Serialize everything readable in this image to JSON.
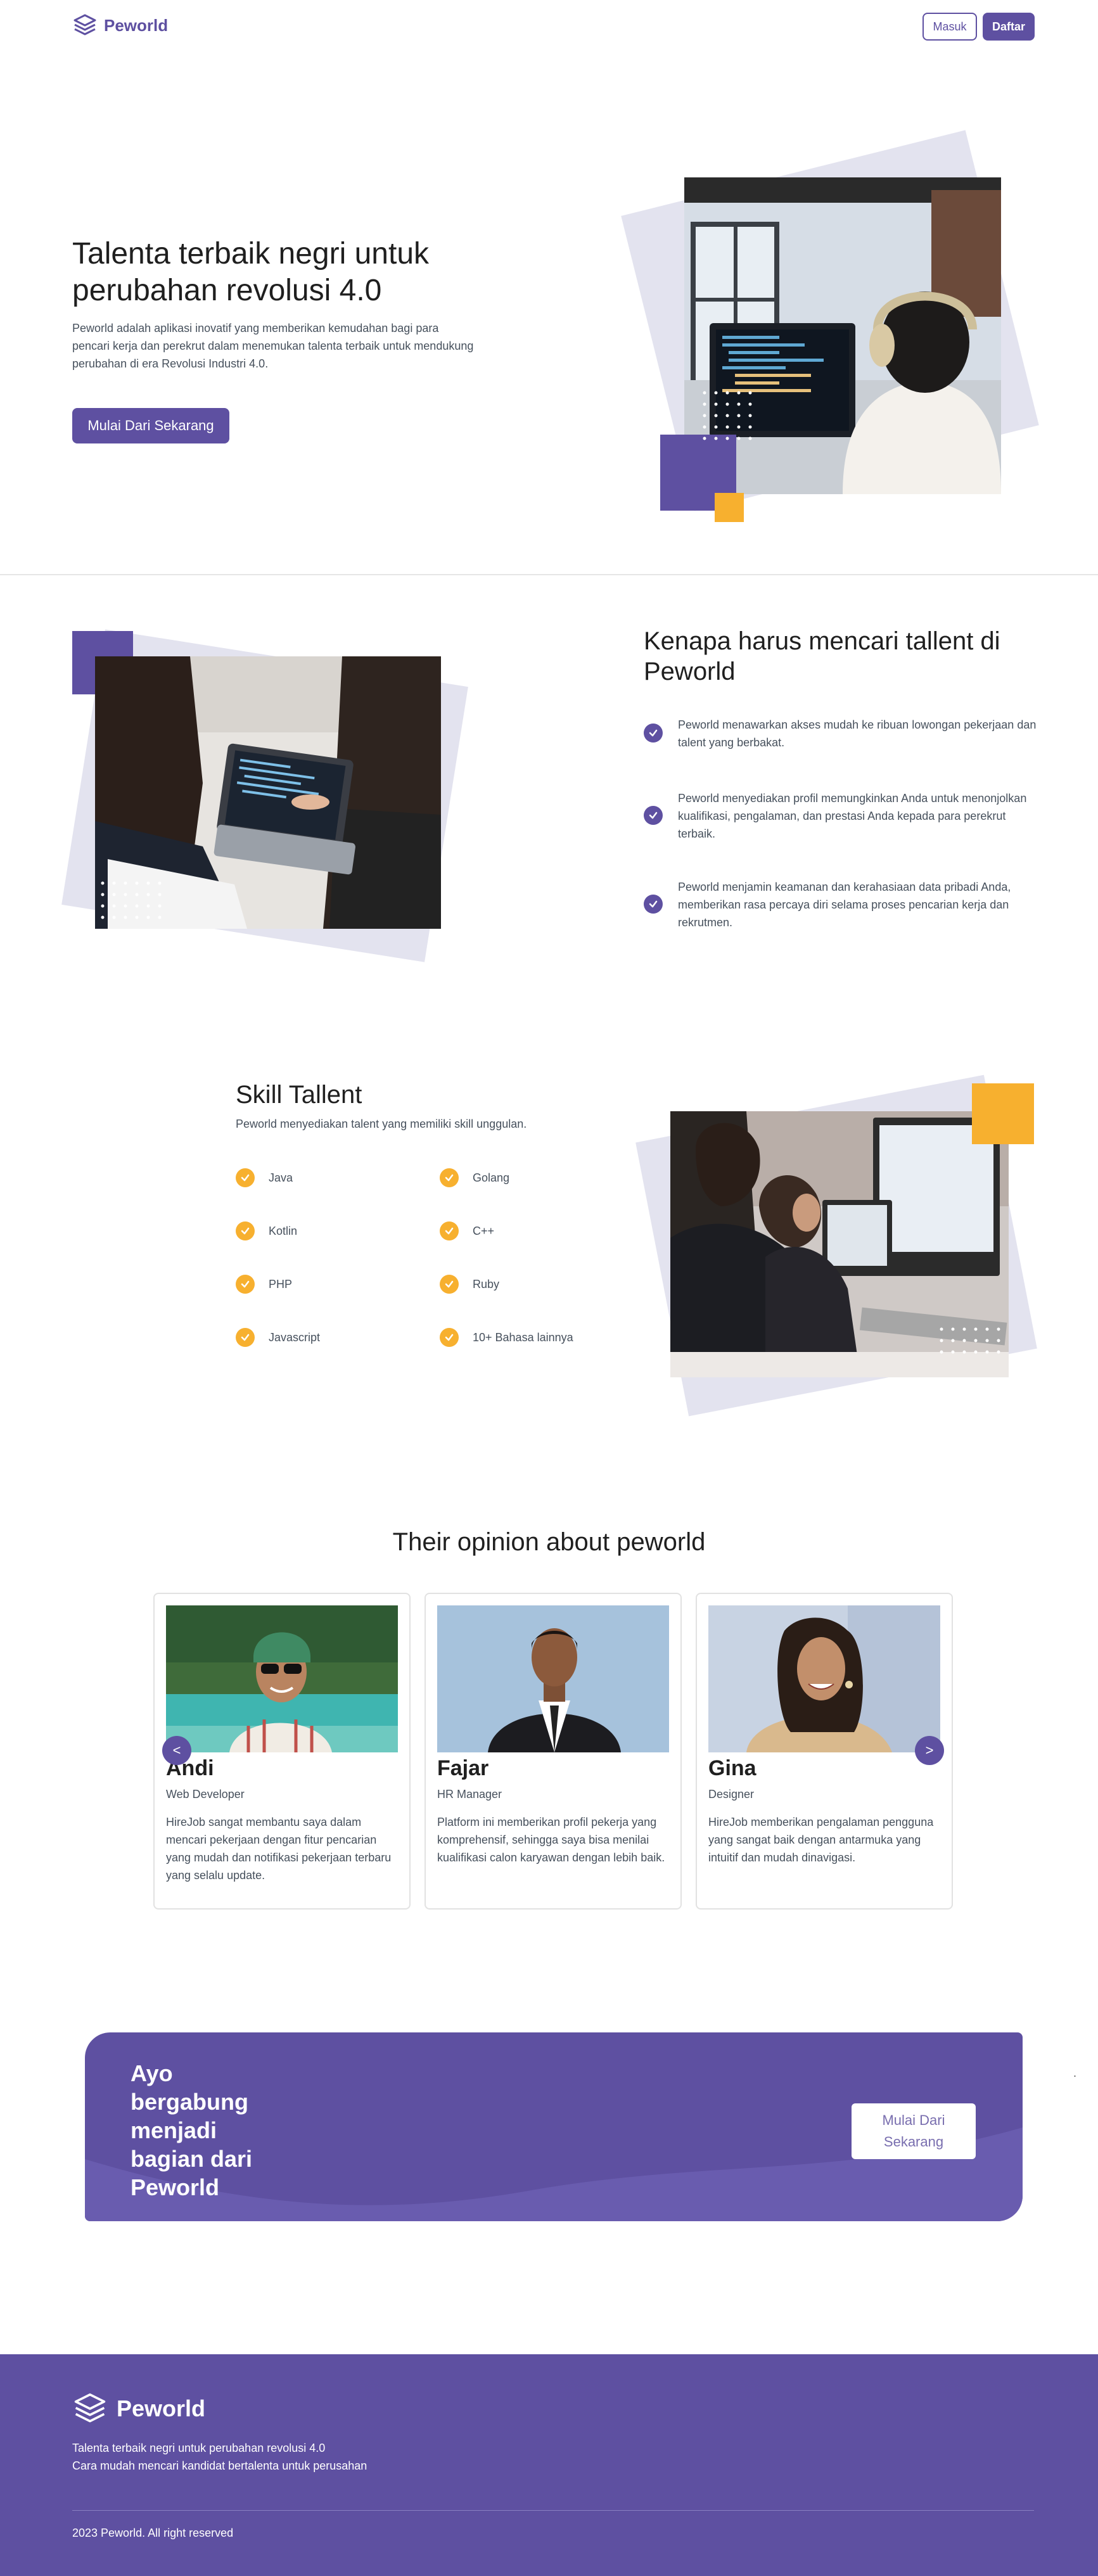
{
  "colors": {
    "primary": "#5e50a1",
    "accent": "#f7b02f",
    "text": "#1f1f1f",
    "muted": "#46505c"
  },
  "nav": {
    "brand": "Peworld",
    "login_label": "Masuk",
    "register_label": "Daftar"
  },
  "hero": {
    "title": "Talenta terbaik negri untuk perubahan revolusi 4.0",
    "description": "Peworld adalah aplikasi inovatif yang memberikan kemudahan bagi para pencari kerja dan perekrut dalam menemukan talenta terbaik untuk mendukung perubahan di era Revolusi Industri 4.0.",
    "cta_label": "Mulai Dari Sekarang"
  },
  "why": {
    "title": "Kenapa harus mencari tallent di Peworld",
    "items": [
      {
        "text": "Peworld menawarkan akses mudah ke ribuan lowongan pekerjaan dan talent yang berbakat."
      },
      {
        "text": "Peworld menyediakan profil memungkinkan Anda untuk menonjolkan kualifikasi, pengalaman, dan prestasi Anda kepada para perekrut terbaik."
      },
      {
        "text": "Peworld menjamin keamanan dan kerahasiaan data pribadi Anda, memberikan rasa percaya diri selama proses pencarian kerja dan rekrutmen."
      }
    ]
  },
  "skill": {
    "title": "Skill Tallent",
    "subtitle": "Peworld menyediakan talent yang memiliki skill unggulan.",
    "items": [
      "Java",
      "Golang",
      "Kotlin",
      "C++",
      "PHP",
      "Ruby",
      "Javascript",
      "10+ Bahasa lainnya"
    ]
  },
  "opinion": {
    "title": "Their opinion about peworld",
    "prev_label": "<",
    "next_label": ">",
    "cards": [
      {
        "name": "Andi",
        "role": "Web Developer",
        "quote": "HireJob sangat membantu saya dalam mencari pekerjaan dengan fitur pencarian yang mudah dan notifikasi pekerjaan terbaru yang selalu update."
      },
      {
        "name": "Fajar",
        "role": "HR Manager",
        "quote": "Platform ini memberikan profil pekerja yang komprehensif, sehingga saya bisa menilai kualifikasi calon karyawan dengan lebih baik."
      },
      {
        "name": "Gina",
        "role": "Designer",
        "quote": "HireJob memberikan pengalaman pengguna yang sangat baik dengan antarmuka yang intuitif dan mudah dinavigasi."
      }
    ]
  },
  "banner": {
    "text": "Ayo bergabung menjadi bagian dari Peworld",
    "button_label": "Mulai Dari Sekarang",
    "stray_mark": "."
  },
  "footer": {
    "brand": "Peworld",
    "line1": "Talenta terbaik negri untuk perubahan revolusi 4.0",
    "line2": "Cara mudah mencari kandidat bertalenta untuk perusahan",
    "copyright": "2023 Peworld. All right reserved"
  }
}
